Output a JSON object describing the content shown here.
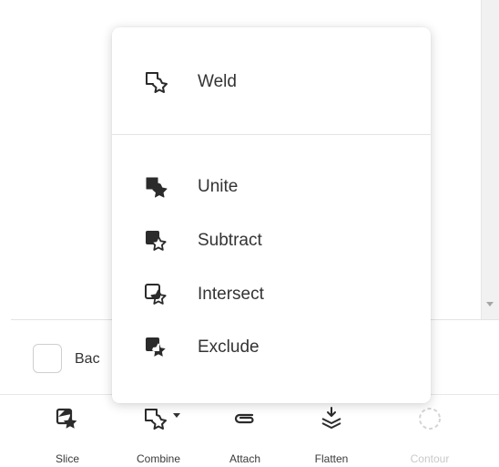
{
  "background": {
    "checkbox_label": "Bac"
  },
  "menu": {
    "items": [
      {
        "label": "Weld",
        "icon": "weld-icon"
      },
      {
        "label": "Unite",
        "icon": "unite-icon"
      },
      {
        "label": "Subtract",
        "icon": "subtract-icon"
      },
      {
        "label": "Intersect",
        "icon": "intersect-icon"
      },
      {
        "label": "Exclude",
        "icon": "exclude-icon"
      }
    ]
  },
  "toolbar": {
    "tools": [
      {
        "label": "Slice",
        "icon": "slice-icon",
        "enabled": true
      },
      {
        "label": "Combine",
        "icon": "combine-icon",
        "enabled": true
      },
      {
        "label": "Attach",
        "icon": "paperclip-icon",
        "enabled": true
      },
      {
        "label": "Flatten",
        "icon": "flatten-icon",
        "enabled": true
      },
      {
        "label": "Contour",
        "icon": "contour-icon",
        "enabled": false
      }
    ]
  },
  "colors": {
    "icon": "#2b2b2b",
    "disabled": "#c9c9c9",
    "divider": "#e4e4e4"
  }
}
